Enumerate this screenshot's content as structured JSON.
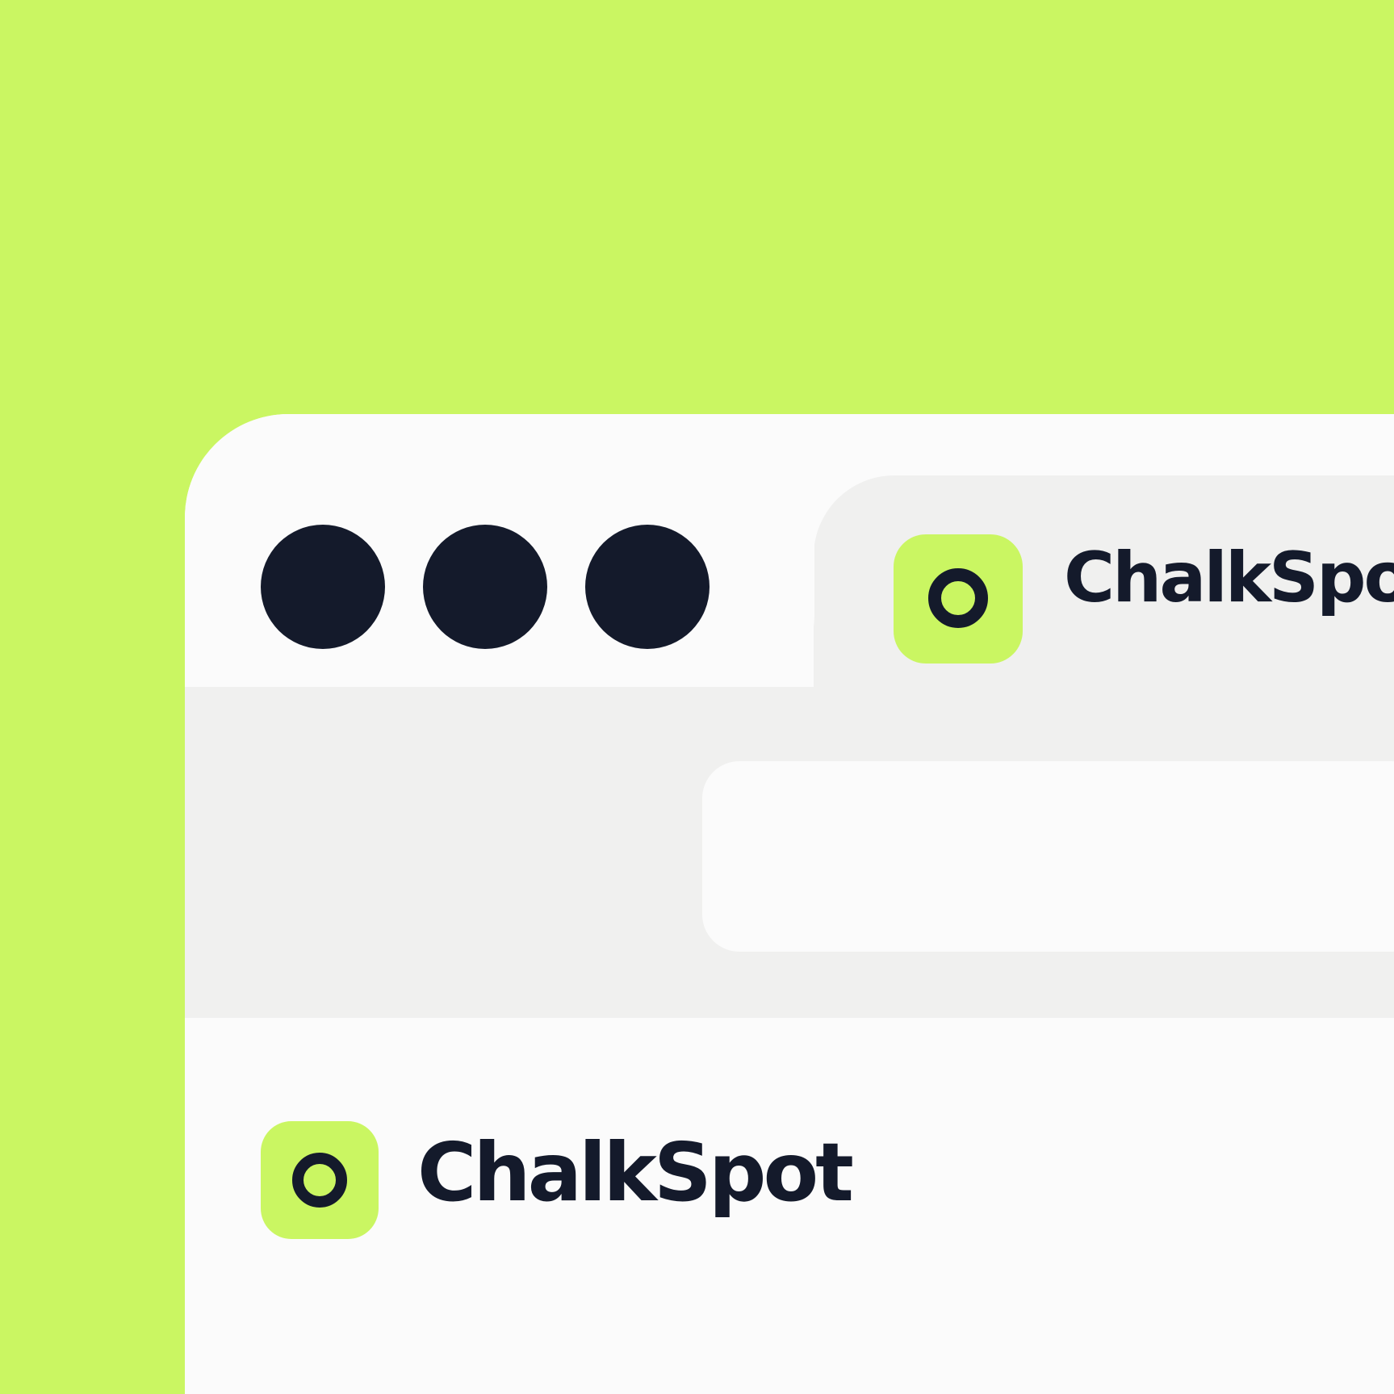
{
  "colors": {
    "background": "#caf662",
    "window": "#fbfbfb",
    "toolbar": "#f0f0ef",
    "dark": "#141a2b",
    "accent": "#caf662",
    "icon_gray": "#666666",
    "icon_disabled": "#bdbdbd"
  },
  "window_controls": [
    "close-dot",
    "minimize-dot",
    "maximize-dot"
  ],
  "tab": {
    "icon": "chalkspot-logo-icon",
    "title": "ChalkSpot"
  },
  "toolbar": {
    "back_icon": "arrow-left-icon",
    "forward_icon": "arrow-right-icon",
    "forward_enabled": false,
    "home_icon": "home-icon",
    "address_value": ""
  },
  "content": {
    "logo_icon": "chalkspot-logo-icon",
    "brand_name": "ChalkSpot"
  }
}
